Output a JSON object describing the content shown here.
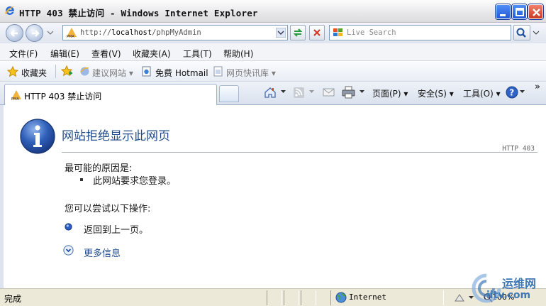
{
  "window": {
    "title": "HTTP 403 禁止访问 - Windows Internet Explorer"
  },
  "addressbar": {
    "url_prefix": "http://",
    "url_host": "localhost",
    "url_path": "/phpMyAdmin",
    "search_placeholder": "Live Search"
  },
  "menu": {
    "items": [
      "文件(F)",
      "编辑(E)",
      "查看(V)",
      "收藏夹(A)",
      "工具(T)",
      "帮助(H)"
    ]
  },
  "favorites": {
    "label": "收藏夹",
    "items": [
      "建议网站 ▾",
      "免费 Hotmail",
      "网页快讯库 ▾"
    ]
  },
  "tab": {
    "title": "HTTP 403 禁止访问"
  },
  "commandbar": {
    "page": "页面(P) ▾",
    "safety": "安全(S) ▾",
    "tools": "工具(O) ▾",
    "more": "»"
  },
  "content": {
    "heading": "网站拒绝显示此网页",
    "code": "HTTP 403",
    "cause_title": "最可能的原因是:",
    "cause_item": "此网站要求您登录。",
    "action_title": "您可以尝试以下操作:",
    "action_back": "返回到上一页。",
    "action_more": "更多信息"
  },
  "status": {
    "text": "完成",
    "zone": "Internet",
    "zoom": "100%"
  },
  "watermark": {
    "line1": "运维网",
    "line2": "iitv.com"
  },
  "colors": {
    "heading": "#1f4b8a",
    "titlebar_button": "#2a62dd",
    "close_button": "#d44a2c"
  }
}
